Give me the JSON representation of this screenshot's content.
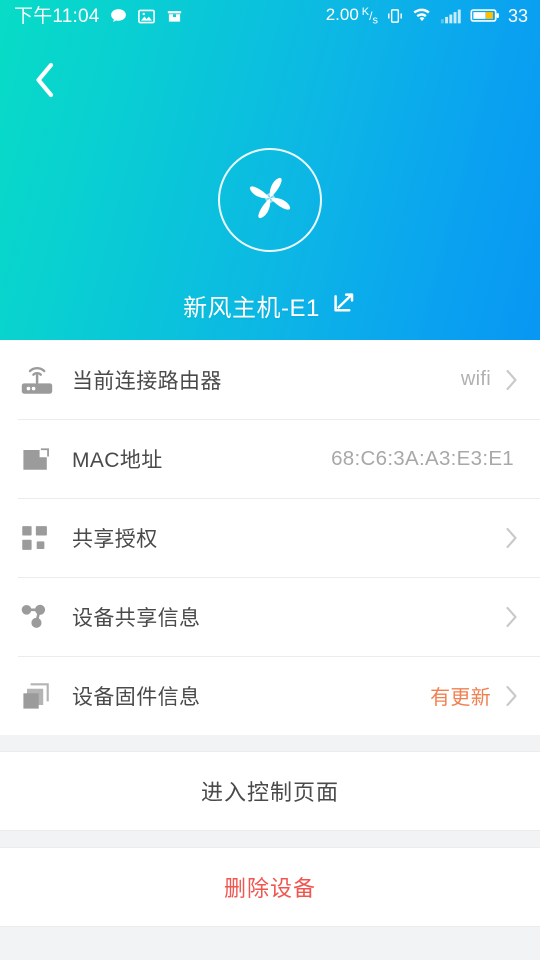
{
  "statusbar": {
    "time": "下午11:04",
    "icons_left": [
      "chat-bubble-icon",
      "image-icon",
      "mail-icon"
    ],
    "net_speed": "2.00",
    "net_speed_unit_top": "K",
    "net_speed_unit_bottom": "s",
    "icons_right": [
      "vibrate-icon",
      "wifi-icon",
      "signal-bars-icon",
      "battery-icon"
    ],
    "battery_level": "33",
    "battery_fill_color": "#ffc107"
  },
  "header": {
    "back_icon": "chevron-left-icon",
    "logo_icon": "pinwheel-fan-logo",
    "device_name": "新风主机-E1",
    "edit_icon": "edit-pencil-icon",
    "gradient_start": "#08dcc6",
    "gradient_end": "#0897f4"
  },
  "list": {
    "rows": [
      {
        "icon": "router-wifi-icon",
        "label": "当前连接路由器",
        "value": "wifi",
        "value_style": "muted",
        "chevron": true
      },
      {
        "icon": "mac-card-icon",
        "label": "MAC地址",
        "value": "68:C6:3A:A3:E3:E1",
        "value_style": "mac",
        "chevron": false
      },
      {
        "icon": "qr-grid-icon",
        "label": "共享授权",
        "value": "",
        "value_style": "muted",
        "chevron": true
      },
      {
        "icon": "share-nodes-icon",
        "label": "设备共享信息",
        "value": "",
        "value_style": "muted",
        "chevron": true
      },
      {
        "icon": "layers-stack-icon",
        "label": "设备固件信息",
        "value": "有更新",
        "value_style": "orange",
        "chevron": true
      }
    ]
  },
  "actions": {
    "enter_control": "进入控制页面",
    "delete_device": "删除设备",
    "delete_color": "#f0564f"
  }
}
